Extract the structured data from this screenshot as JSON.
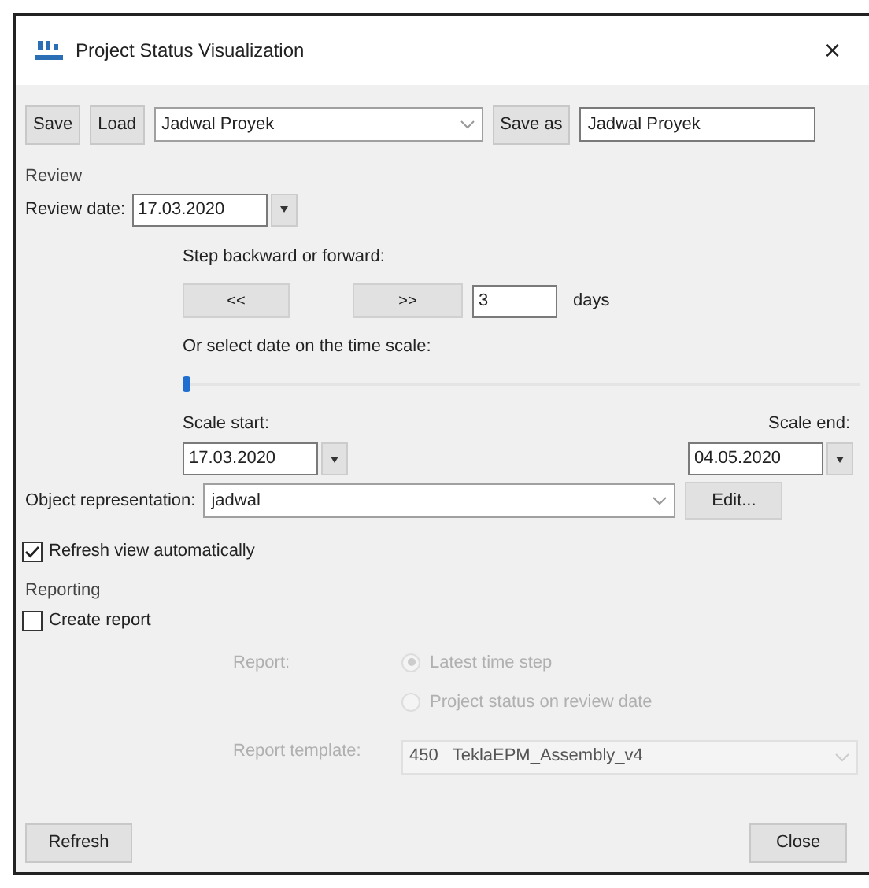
{
  "window": {
    "title": "Project Status Visualization",
    "close": "×"
  },
  "toolbar": {
    "save": "Save",
    "load": "Load",
    "settings": "Jadwal Proyek",
    "save_as": "Save as",
    "save_as_name": "Jadwal Proyek"
  },
  "review": {
    "title": "Review",
    "date_label": "Review date:",
    "date": "17.03.2020",
    "step_label": "Step backward or forward:",
    "back": "<<",
    "forward": ">>",
    "step_days": "3",
    "days_label": "days",
    "scale_label": "Or select date on the time scale:",
    "level": 0.0,
    "scale_start_label": "Scale start:",
    "scale_start": "17.03.2020",
    "scale_end_label": "Scale end:",
    "scale_end": "04.05.2020"
  },
  "object_representation": {
    "label": "Object representation:",
    "value": "jadwal",
    "edit": "Edit..."
  },
  "refresh_auto": {
    "label": "Refresh view automatically",
    "checked": true
  },
  "reporting": {
    "title": "Reporting",
    "create_report": {
      "label": "Create report",
      "checked": false
    },
    "disabled": true,
    "report_label": "Report:",
    "options": [
      {
        "label": "Latest time step",
        "selected": true
      },
      {
        "label": "Project status on review date",
        "selected": false
      }
    ],
    "template_label": "Report template:",
    "template": "450   TeklaEPM_Assembly_v4"
  },
  "footer": {
    "refresh": "Refresh",
    "close": "Close"
  }
}
